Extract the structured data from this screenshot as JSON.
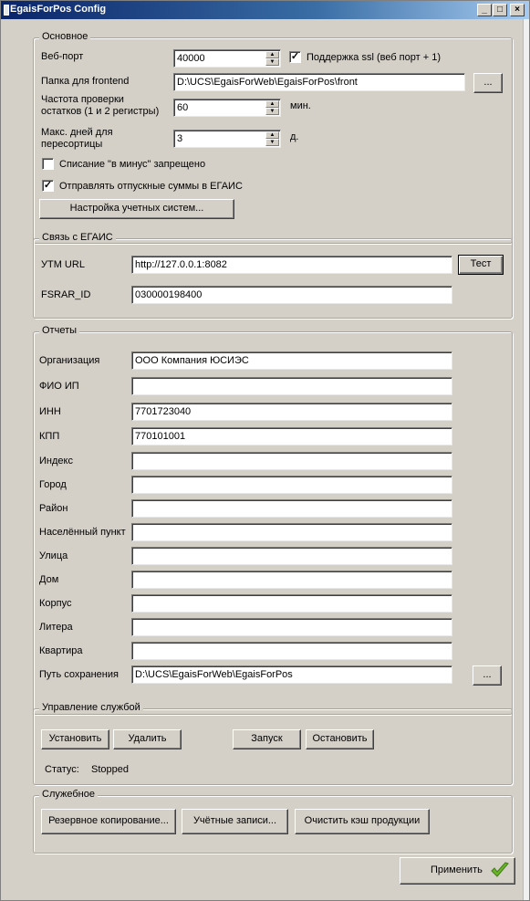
{
  "window": {
    "title": "EgaisForPos Config",
    "minimize": "_",
    "maximize": "□",
    "close": "×"
  },
  "main": {
    "legend": "Основное",
    "web_port": {
      "label": "Веб-порт",
      "value": "40000"
    },
    "ssl": {
      "checked": true,
      "label": "Поддержка ssl (веб порт + 1)"
    },
    "frontend": {
      "label": "Папка для frontend",
      "value": "D:\\UCS\\EgaisForWeb\\EgaisForPos\\front",
      "browse": "..."
    },
    "check_freq": {
      "label_line1": "Частота проверки",
      "label_line2": "остатков (1 и 2 регистры)",
      "value": "60",
      "unit": "мин."
    },
    "max_days": {
      "label_line1": "Макс. дней для",
      "label_line2": "пересортицы",
      "value": "3",
      "unit": "д."
    },
    "minus_writeoff": {
      "checked": false,
      "label": "Списание \"в минус\" запрещено"
    },
    "send_sums": {
      "checked": true,
      "label": "Отправлять отпускные суммы в ЕГАИС"
    },
    "accounting_btn": "Настройка учетных систем..."
  },
  "egais": {
    "legend": "Связь с ЕГАИС",
    "utm_label": "УТМ URL",
    "utm_value": "http://127.0.0.1:8082",
    "test_btn": "Тест",
    "fsrar_label": "FSRAR_ID",
    "fsrar_value": "030000198400"
  },
  "reports": {
    "legend": "Отчеты",
    "fields": [
      {
        "label": "Организация",
        "value": "ООО Компания ЮСИЭС"
      },
      {
        "label": "ФИО ИП",
        "value": ""
      },
      {
        "label": "ИНН",
        "value": "7701723040"
      },
      {
        "label": "КПП",
        "value": "770101001"
      },
      {
        "label": "Индекс",
        "value": ""
      },
      {
        "label": "Город",
        "value": ""
      },
      {
        "label": "Район",
        "value": ""
      },
      {
        "label": "Населённый пункт",
        "value": ""
      },
      {
        "label": "Улица",
        "value": ""
      },
      {
        "label": "Дом",
        "value": ""
      },
      {
        "label": "Корпус",
        "value": ""
      },
      {
        "label": "Литера",
        "value": ""
      },
      {
        "label": "Квартира",
        "value": ""
      },
      {
        "label": "Путь сохранения",
        "value": "D:\\UCS\\EgaisForWeb\\EgaisForPos"
      }
    ],
    "browse": "..."
  },
  "service": {
    "legend": "Управление службой",
    "install": "Установить",
    "remove": "Удалить",
    "start": "Запуск",
    "stop": "Остановить",
    "status_label": "Статус:",
    "status_value": "Stopped"
  },
  "utility": {
    "legend": "Служебное",
    "backup": "Резервное копирование...",
    "accounts": "Учётные записи...",
    "clear_cache": "Очистить кэш продукции"
  },
  "apply": {
    "label": "Применить"
  },
  "colors": {
    "title_bar": "#0a246a",
    "window_bg": "#d4d0c8",
    "check_green": "#6ab52a"
  }
}
